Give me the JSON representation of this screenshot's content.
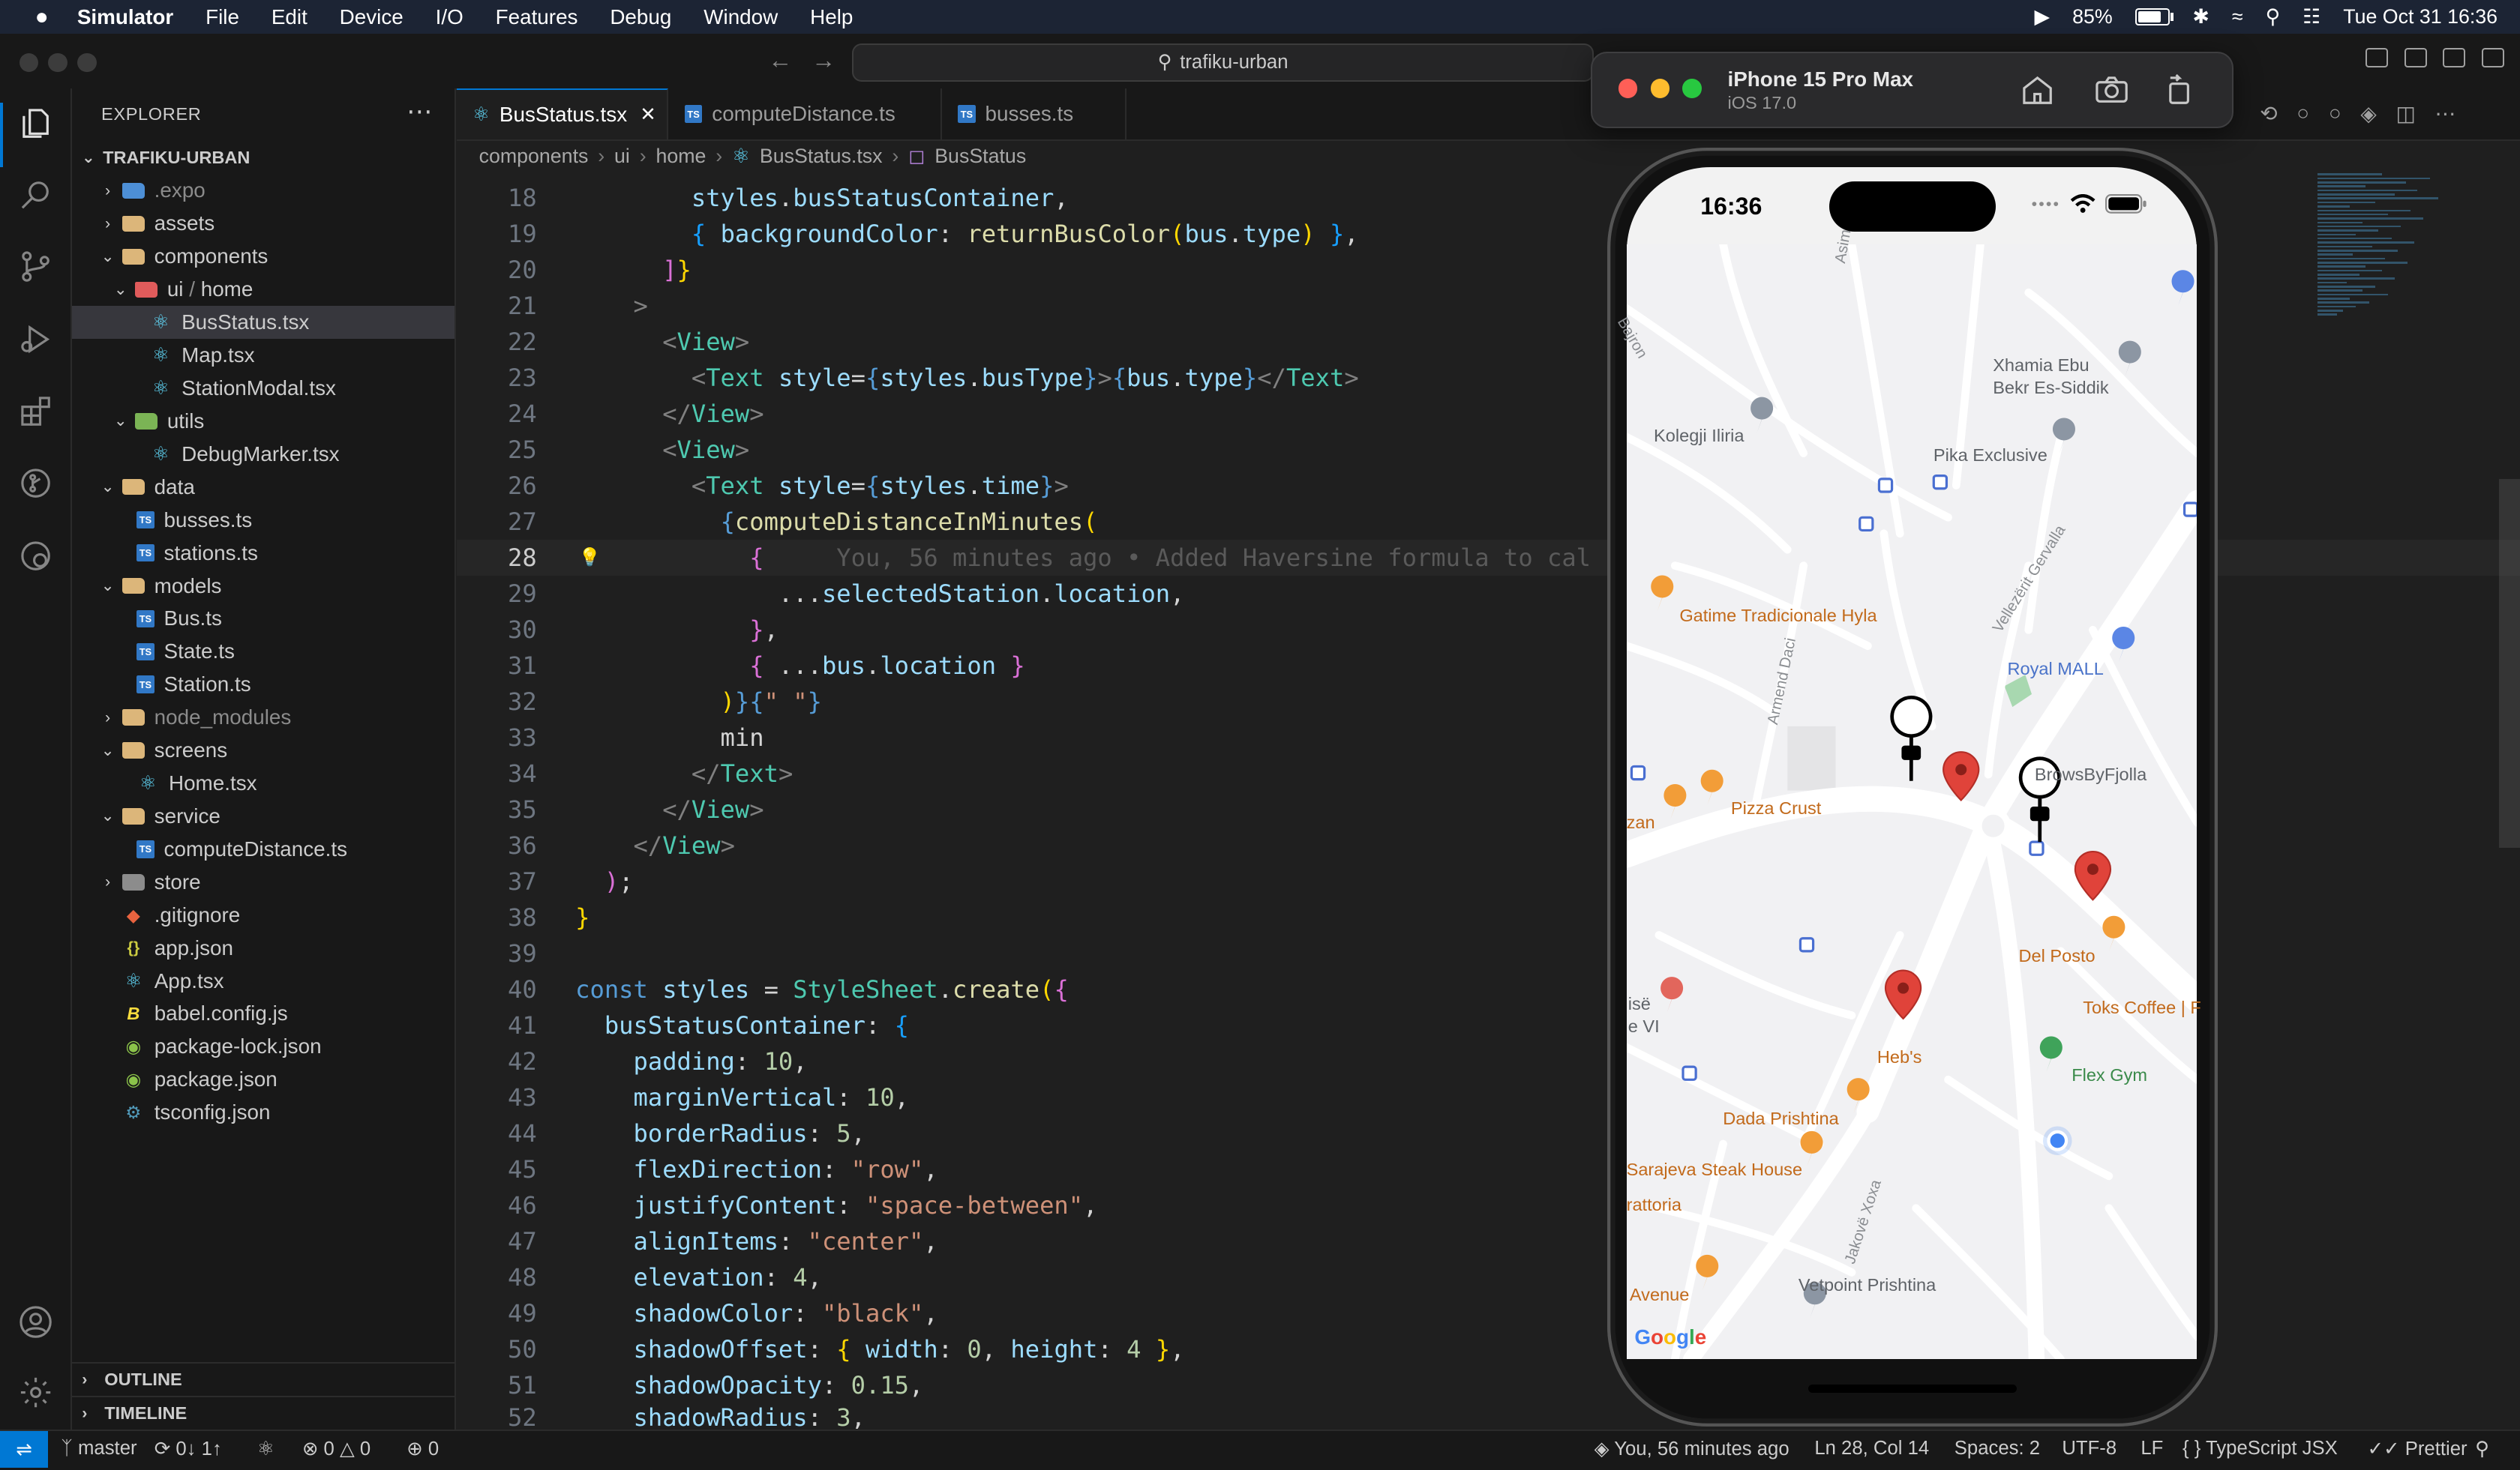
{
  "menubar": {
    "apple": "",
    "app": "Simulator",
    "items": [
      "File",
      "Edit",
      "Device",
      "I/O",
      "Features",
      "Debug",
      "Window",
      "Help"
    ],
    "battery": "85%",
    "datetime": "Tue Oct 31  16:36"
  },
  "titlebar": {
    "project": "trafiku-urban"
  },
  "explorer": {
    "title": "EXPLORER",
    "root": "TRAFIKU-URBAN",
    "items": [
      {
        "label": ".expo"
      },
      {
        "label": "assets"
      },
      {
        "label": "components"
      },
      {
        "label": "ui"
      },
      {
        "label": "home"
      },
      {
        "label": "BusStatus.tsx"
      },
      {
        "label": "Map.tsx"
      },
      {
        "label": "StationModal.tsx"
      },
      {
        "label": "utils"
      },
      {
        "label": "DebugMarker.tsx"
      },
      {
        "label": "data"
      },
      {
        "label": "busses.ts"
      },
      {
        "label": "stations.ts"
      },
      {
        "label": "models"
      },
      {
        "label": "Bus.ts"
      },
      {
        "label": "State.ts"
      },
      {
        "label": "Station.ts"
      },
      {
        "label": "node_modules"
      },
      {
        "label": "screens"
      },
      {
        "label": "Home.tsx"
      },
      {
        "label": "service"
      },
      {
        "label": "computeDistance.ts"
      },
      {
        "label": "store"
      },
      {
        "label": ".gitignore"
      },
      {
        "label": "app.json"
      },
      {
        "label": "App.tsx"
      },
      {
        "label": "babel.config.js"
      },
      {
        "label": "package-lock.json"
      },
      {
        "label": "package.json"
      },
      {
        "label": "tsconfig.json"
      }
    ],
    "outline": "OUTLINE",
    "timeline": "TIMELINE"
  },
  "tabs": [
    {
      "label": "BusStatus.tsx"
    },
    {
      "label": "computeDistance.ts"
    },
    {
      "label": "busses.ts"
    }
  ],
  "breadcrumb": [
    "components",
    "ui",
    "home",
    "BusStatus.tsx",
    "BusStatus"
  ],
  "code": {
    "line_numbers": [
      "18",
      "19",
      "20",
      "21",
      "22",
      "23",
      "24",
      "25",
      "26",
      "27",
      "28",
      "29",
      "30",
      "31",
      "32",
      "33",
      "34",
      "35",
      "36",
      "37",
      "38",
      "39",
      "40",
      "41",
      "42",
      "43",
      "44",
      "45",
      "46",
      "47",
      "48",
      "49",
      "50",
      "51",
      "52"
    ],
    "blame": "You, 56 minutes ago • Added Haversine formula to cal"
  },
  "statusbar": {
    "branch": "master",
    "sync": "0↓ 1↑",
    "problems": "0",
    "warnings": "0",
    "ports": "0",
    "blame": "You, 56 minutes ago",
    "position": "Ln 28, Col 14",
    "spaces": "Spaces: 2",
    "encoding": "UTF-8",
    "eol": "LF",
    "language": "TypeScript JSX",
    "formatter": "Prettier"
  },
  "simulator": {
    "device": "iPhone 15 Pro Max",
    "os": "iOS 17.0",
    "phone_time": "16:36"
  },
  "map": {
    "labels": {
      "xhamia": "Xhamia Ebu",
      "xhamia2": "Bekr Es-Siddik",
      "kolegji": "Kolegji Iliria",
      "pika": "Pika Exclusive",
      "gatime": "Gatime Tradicionale Hyla",
      "royal": "Royal MALL",
      "brows": "BrowsByFjolla",
      "pizza": "Pizza Crust",
      "zan": "zan",
      "delposto": "Del Posto",
      "toks": "Toks Coffee | F",
      "heb": "Heb's",
      "flex": "Flex Gym",
      "dada": "Dada Prishtina",
      "sarajeva": "Sarajeva Steak House",
      "ratoria": "rattoria",
      "avenue": "Avenue",
      "vetpoint": "Vetpoint Prishtina",
      "ise": "isë",
      "vi": "e VI",
      "asim": "Asim L",
      "bajron": "Bajron",
      "armend": "Armend Daci",
      "vellezerit": "Vellezërit Gervalla",
      "jakove": "Jakovë Xoxa",
      "google": "Google"
    }
  }
}
